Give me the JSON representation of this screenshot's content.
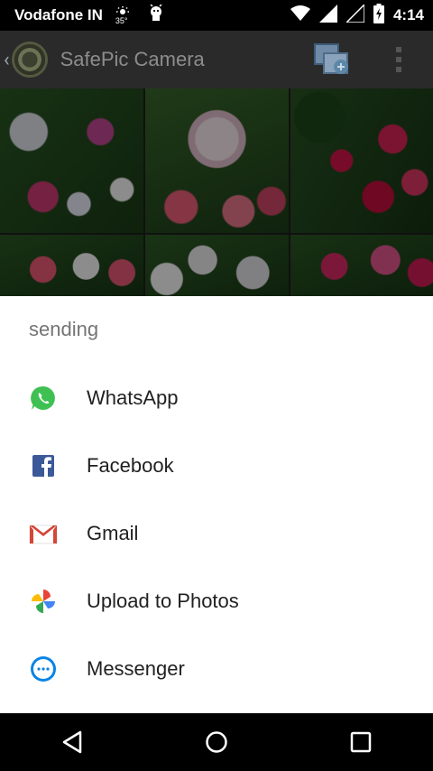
{
  "status_bar": {
    "carrier": "Vodafone IN",
    "weather_temp": "35°",
    "time": "4:14"
  },
  "app_bar": {
    "title": "SafePic Camera"
  },
  "share_sheet": {
    "title": "sending",
    "apps": [
      {
        "label": "WhatsApp",
        "icon": "whatsapp-icon"
      },
      {
        "label": "Facebook",
        "icon": "facebook-icon"
      },
      {
        "label": "Gmail",
        "icon": "gmail-icon"
      },
      {
        "label": "Upload to Photos",
        "icon": "photos-icon"
      },
      {
        "label": "Messenger",
        "icon": "messenger-icon"
      }
    ]
  },
  "colors": {
    "whatsapp": "#3fc053",
    "facebook": "#3b5998",
    "gmail": "#d44638",
    "messenger": "#0a84e6"
  }
}
